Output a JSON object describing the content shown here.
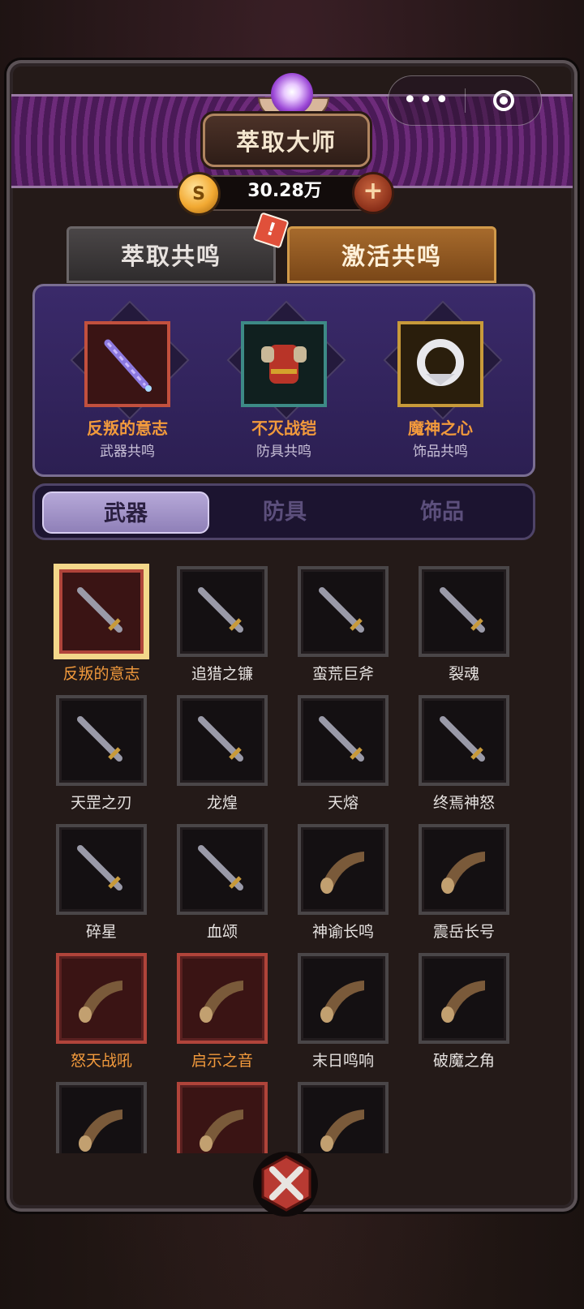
{
  "header": {
    "title": "萃取大师",
    "currency_value": "30.28万"
  },
  "mini_program_menu": {
    "more_label": "•••"
  },
  "tabs": [
    {
      "label": "萃取共鸣",
      "active": false,
      "alert": "!"
    },
    {
      "label": "激活共鸣",
      "active": true
    }
  ],
  "resonance": [
    {
      "name": "反叛的意志",
      "type": "武器共鸣",
      "icon": "sword-icon",
      "frame_color": "#c2503e"
    },
    {
      "name": "不灭战铠",
      "type": "防具共鸣",
      "icon": "armor-icon",
      "frame_color": "#3d8a86"
    },
    {
      "name": "魔神之心",
      "type": "饰品共鸣",
      "icon": "amulet-icon",
      "frame_color": "#c89a3a"
    }
  ],
  "categories": [
    {
      "label": "武器",
      "active": true
    },
    {
      "label": "防具",
      "active": false
    },
    {
      "label": "饰品",
      "active": false
    }
  ],
  "items": [
    {
      "name": "反叛的意志",
      "icon": "crystal-sword-icon",
      "frame": "selected",
      "orange": true
    },
    {
      "name": "追猎之镰",
      "icon": "sickle-icon",
      "frame": "normal",
      "orange": false
    },
    {
      "name": "蛮荒巨斧",
      "icon": "axe-icon",
      "frame": "normal",
      "orange": false
    },
    {
      "name": "裂魂",
      "icon": "dagger-icon",
      "frame": "normal",
      "orange": false
    },
    {
      "name": "天罡之刃",
      "icon": "green-blade-icon",
      "frame": "normal",
      "orange": false
    },
    {
      "name": "龙煌",
      "icon": "bronze-sword-icon",
      "frame": "normal",
      "orange": false
    },
    {
      "name": "天熔",
      "icon": "mace-icon",
      "frame": "normal",
      "orange": false
    },
    {
      "name": "终焉神怒",
      "icon": "feather-blade-icon",
      "frame": "normal",
      "orange": false
    },
    {
      "name": "碎星",
      "icon": "short-sword-icon",
      "frame": "normal",
      "orange": false
    },
    {
      "name": "血颂",
      "icon": "purple-mace-icon",
      "frame": "normal",
      "orange": false
    },
    {
      "name": "神谕长鸣",
      "icon": "horn-icon",
      "frame": "normal",
      "orange": false
    },
    {
      "name": "震岳长号",
      "icon": "purple-horn-icon",
      "frame": "normal",
      "orange": false
    },
    {
      "name": "怒天战吼",
      "icon": "green-horn-icon",
      "frame": "red",
      "orange": true
    },
    {
      "name": "启示之音",
      "icon": "violet-horn-icon",
      "frame": "red",
      "orange": true
    },
    {
      "name": "末日鸣响",
      "icon": "blue-horn-icon",
      "frame": "normal",
      "orange": false
    },
    {
      "name": "破魔之角",
      "icon": "jade-horn-icon",
      "frame": "normal",
      "orange": false
    },
    {
      "name": "",
      "icon": "gold-horn-icon",
      "frame": "normal",
      "orange": false
    },
    {
      "name": "",
      "icon": "ornate-horn-icon",
      "frame": "red",
      "orange": false
    },
    {
      "name": "",
      "icon": "bronze-horn-icon",
      "frame": "normal",
      "orange": false
    }
  ],
  "colors": {
    "accent_orange": "#f29a3c",
    "panel_purple": "#3a2a6a",
    "rare_red": "#b0443a",
    "selected_gold": "#f3d78a"
  }
}
